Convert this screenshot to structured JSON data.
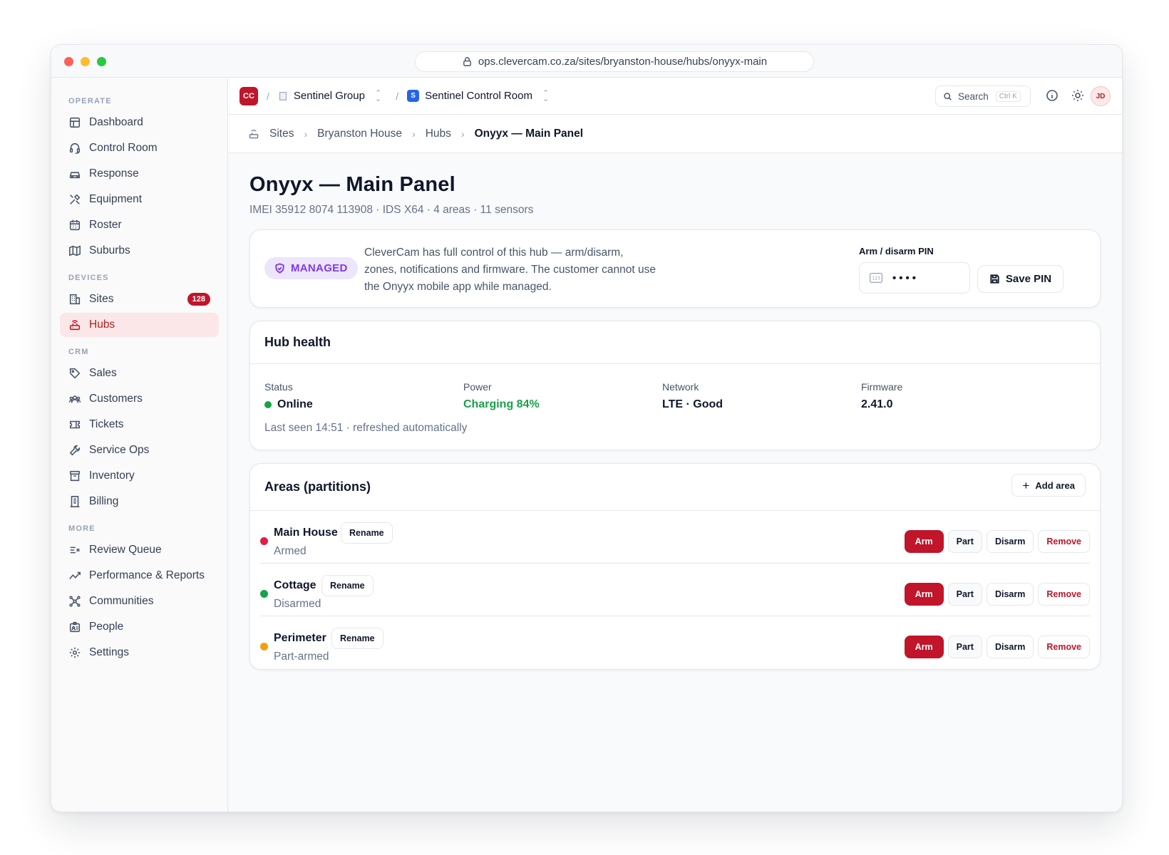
{
  "browser": {
    "url": "ops.clevercam.co.za/sites/bryanston-house/hubs/onyyx-main"
  },
  "sidebar": {
    "sections": [
      {
        "label": "OPERATE",
        "items": [
          {
            "label": "Dashboard",
            "icon": "dashboard-icon"
          },
          {
            "label": "Control Room",
            "icon": "headset-icon"
          },
          {
            "label": "Response",
            "icon": "car-icon"
          },
          {
            "label": "Equipment",
            "icon": "tools-icon"
          },
          {
            "label": "Roster",
            "icon": "calendar-icon"
          },
          {
            "label": "Suburbs",
            "icon": "map-icon"
          }
        ]
      },
      {
        "label": "DEVICES",
        "items": [
          {
            "label": "Sites",
            "icon": "building-icon",
            "badge": "128"
          },
          {
            "label": "Hubs",
            "icon": "router-icon",
            "active": true
          }
        ]
      },
      {
        "label": "CRM",
        "items": [
          {
            "label": "Sales",
            "icon": "tag-icon"
          },
          {
            "label": "Customers",
            "icon": "users-icon"
          },
          {
            "label": "Tickets",
            "icon": "ticket-icon"
          },
          {
            "label": "Service Ops",
            "icon": "wrench-icon"
          },
          {
            "label": "Inventory",
            "icon": "archive-icon"
          },
          {
            "label": "Billing",
            "icon": "receipt-icon"
          }
        ]
      },
      {
        "label": "MORE",
        "items": [
          {
            "label": "Review Queue",
            "icon": "list-check-icon"
          },
          {
            "label": "Performance & Reports",
            "icon": "trend-icon"
          },
          {
            "label": "Communities",
            "icon": "network-icon"
          },
          {
            "label": "People",
            "icon": "id-card-icon"
          },
          {
            "label": "Settings",
            "icon": "gear-icon"
          }
        ]
      }
    ]
  },
  "topbar": {
    "org_initials": "CC",
    "org_name": "Sentinel Group",
    "workspace_initial": "S",
    "workspace_name": "Sentinel Control Room",
    "search_label": "Search",
    "search_shortcut": "Ctrl K",
    "user_initials": "JD"
  },
  "breadcrumbs": {
    "items": [
      "Sites",
      "Bryanston House",
      "Hubs"
    ],
    "current": "Onyyx — Main Panel"
  },
  "page": {
    "title": "Onyyx — Main Panel",
    "subtitle": "IMEI 35912 8074 113908 · IDS X64 · 4 areas · 11 sensors"
  },
  "managed": {
    "badge": "MANAGED",
    "description": "CleverCam has full control of this hub — arm/disarm, zones, notifications and firmware. The customer cannot use the Onyyx mobile app while managed.",
    "pin_label": "Arm / disarm PIN",
    "pin_value": "••••",
    "save_label": "Save PIN"
  },
  "health": {
    "title": "Hub health",
    "status_label": "Status",
    "status_value": "Online",
    "power_label": "Power",
    "power_value": "Charging 84%",
    "network_label": "Network",
    "network_value": "LTE · Good",
    "firmware_label": "Firmware",
    "firmware_value": "2.41.0",
    "last_seen": "Last seen 14:51 · refreshed automatically",
    "colors": {
      "online": "#16a34a",
      "charging": "#16a34a"
    }
  },
  "areas": {
    "title": "Areas (partitions)",
    "add_label": "Add area",
    "rename_label": "Rename",
    "arm_label": "Arm",
    "part_label": "Part",
    "disarm_label": "Disarm",
    "remove_label": "Remove",
    "rows": [
      {
        "name": "Main House",
        "state": "Armed",
        "color": "#e11d48"
      },
      {
        "name": "Cottage",
        "state": "Disarmed",
        "color": "#16a34a"
      },
      {
        "name": "Perimeter",
        "state": "Part-armed",
        "color": "#f59e0b"
      }
    ]
  },
  "colors": {
    "brand": "#c0152a",
    "managed": "#7c3aed"
  }
}
